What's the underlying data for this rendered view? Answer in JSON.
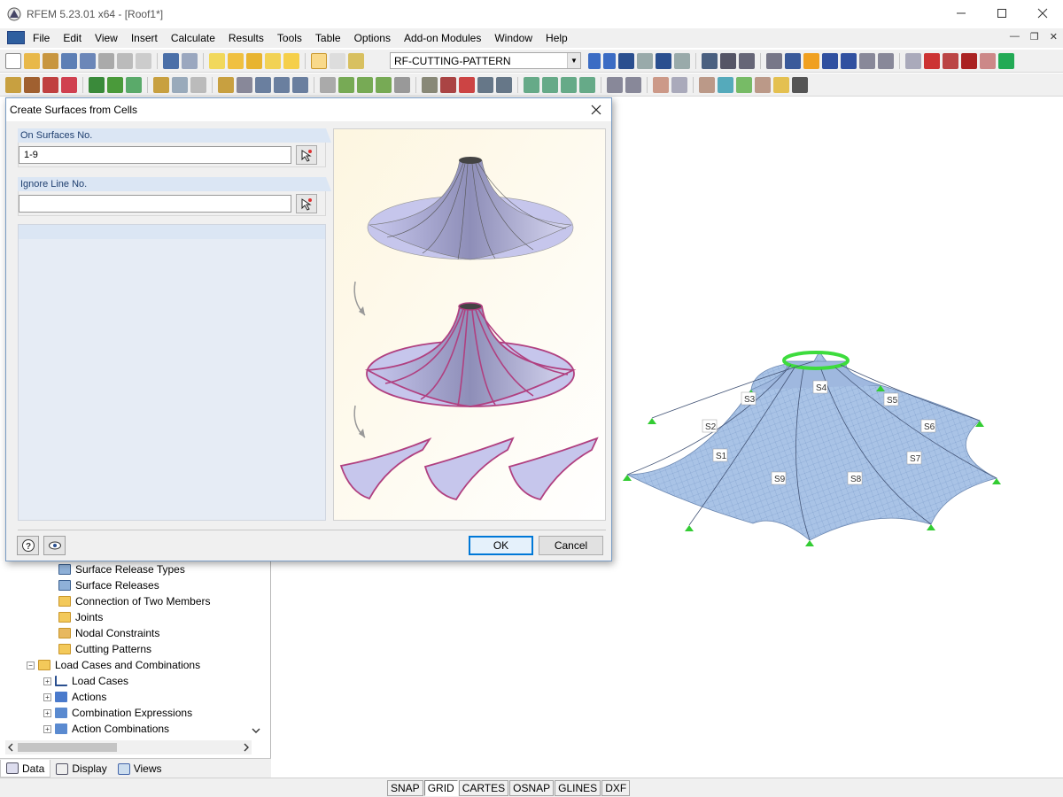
{
  "window": {
    "title": "RFEM 5.23.01 x64 - [Roof1*]"
  },
  "menu": {
    "items": [
      "File",
      "Edit",
      "View",
      "Insert",
      "Calculate",
      "Results",
      "Tools",
      "Table",
      "Options",
      "Add-on Modules",
      "Window",
      "Help"
    ]
  },
  "toolbar": {
    "module_select_value": "RF-CUTTING-PATTERN"
  },
  "dialog": {
    "title": "Create Surfaces from Cells",
    "on_surfaces_label": "On Surfaces No.",
    "on_surfaces_value": "1-9",
    "ignore_line_label": "Ignore Line No.",
    "ignore_line_value": "",
    "ok_label": "OK",
    "cancel_label": "Cancel"
  },
  "navigator": {
    "items": [
      {
        "label": "Surface Release Types",
        "icon": "surface-icon",
        "level": 2
      },
      {
        "label": "Surface Releases",
        "icon": "surface-icon",
        "level": 2
      },
      {
        "label": "Connection of Two Members",
        "icon": "folder-icon",
        "level": 2
      },
      {
        "label": "Joints",
        "icon": "folder-icon",
        "level": 2
      },
      {
        "label": "Nodal Constraints",
        "icon": "constraint-icon",
        "level": 2
      },
      {
        "label": "Cutting Patterns",
        "icon": "folder-icon",
        "level": 2
      },
      {
        "label": "Load Cases and Combinations",
        "icon": "folder-icon",
        "level": 1
      },
      {
        "label": "Load Cases",
        "icon": "load-case-icon",
        "level": 2
      },
      {
        "label": "Actions",
        "icon": "actions-icon",
        "level": 2
      },
      {
        "label": "Combination Expressions",
        "icon": "combination-icon",
        "level": 2
      },
      {
        "label": "Action Combinations",
        "icon": "combination-icon",
        "level": 2
      }
    ],
    "tabs": [
      "Data",
      "Display",
      "Views"
    ]
  },
  "model": {
    "surface_labels": [
      "S1",
      "S2",
      "S3",
      "S4",
      "S5",
      "S6",
      "S7",
      "S8",
      "S9"
    ]
  },
  "status_bar": {
    "buttons": [
      "SNAP",
      "GRID",
      "CARTES",
      "OSNAP",
      "GLINES",
      "DXF"
    ],
    "pressed": "GRID"
  },
  "colors": {
    "membrane": "#a9c3e6",
    "support": "#33cc33",
    "highlight": "#b04080",
    "dialog_header": "#dbe6f4"
  }
}
